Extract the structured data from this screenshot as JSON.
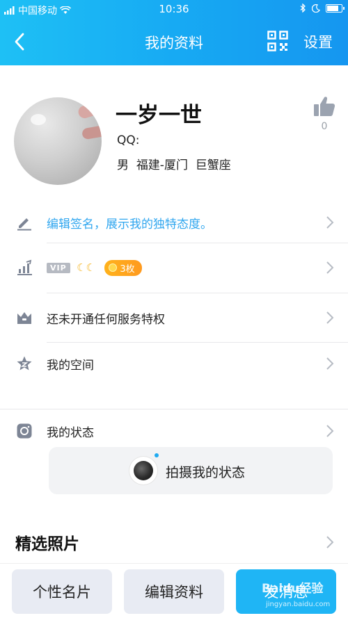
{
  "status_bar": {
    "carrier": "中国移动",
    "time": "10:36"
  },
  "nav": {
    "title": "我的资料",
    "settings_label": "设置"
  },
  "profile": {
    "nickname": "一岁一世",
    "qq_label": "QQ:",
    "gender": "男",
    "location": "福建-厦门",
    "zodiac": "巨蟹座",
    "like_count": "0"
  },
  "rows": {
    "signature": "编辑签名，展示我的独特态度。",
    "vip_tag": "VIP",
    "coin_count": "3枚",
    "service": "还未开通任何服务特权",
    "space": "我的空间",
    "status": "我的状态"
  },
  "status_card": {
    "label": "拍摄我的状态"
  },
  "photos": {
    "title": "精选照片"
  },
  "bottom": {
    "card_label": "个性名片",
    "edit_label": "编辑资料",
    "message_label": "发消息"
  },
  "watermark": {
    "text": "Baidu经验",
    "url": "jingyan.baidu.com"
  },
  "colors": {
    "header": "#17aaf3",
    "signature_text": "#2fa6ef",
    "coin_badge": "#ffa61f",
    "primary_button": "#1fb5f5"
  }
}
